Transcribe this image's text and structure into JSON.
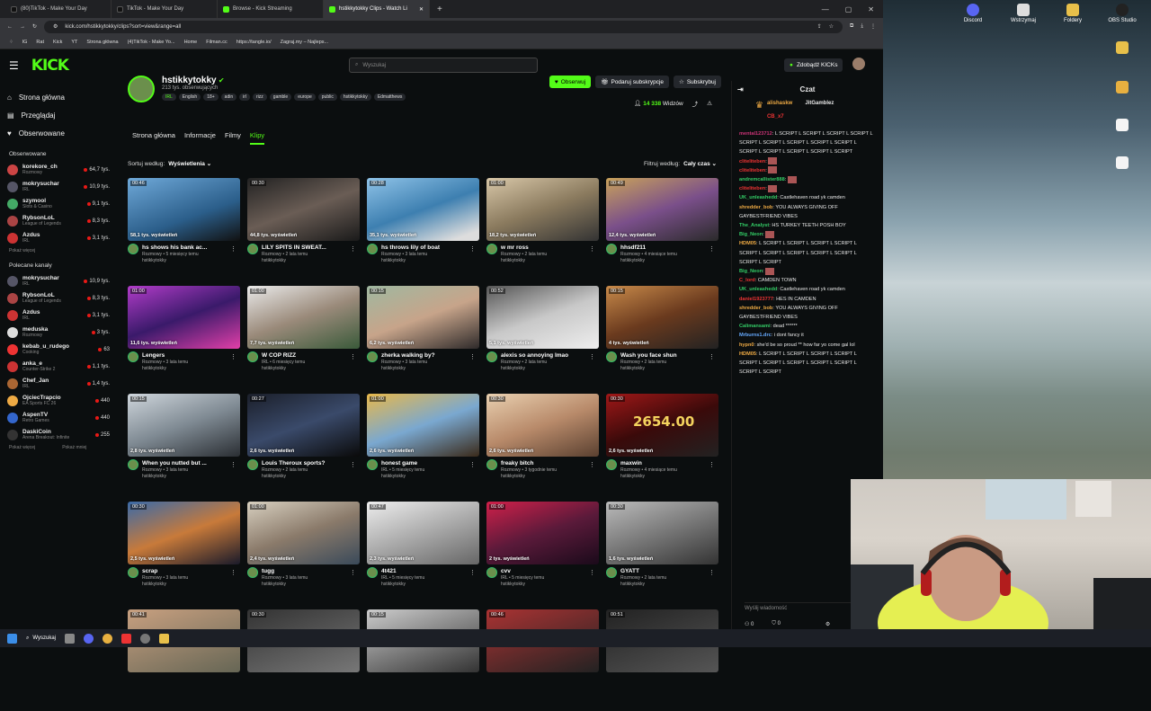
{
  "browser": {
    "tabs": [
      {
        "label": "(80)TikTok - Make Your Day",
        "color": "#222"
      },
      {
        "label": "TikTok - Make Your Day",
        "color": "#222"
      },
      {
        "label": "Browse - Kick Streaming",
        "color": "#53fc18"
      },
      {
        "label": "hstikkytokky Clips - Watch Li",
        "color": "#53fc18"
      }
    ],
    "url": "kick.com/hstikkytokky/clips?sort=view&range=all",
    "bookmarks": [
      "IG",
      "Rat",
      "Kick",
      "YT",
      "Strona główna",
      "(4)TikTok - Make Yo...",
      "Home",
      "Filman.cc",
      "https://tangle.io/",
      "Zagraj.my – Najleps..."
    ]
  },
  "header": {
    "logo": "KICK",
    "search_placeholder": "Wyszukaj",
    "get_kicks": "Zdobądź KICKs"
  },
  "sidebar": {
    "nav": [
      {
        "label": "Strona główna",
        "icon": "home-icon"
      },
      {
        "label": "Przeglądaj",
        "icon": "browse-icon"
      },
      {
        "label": "Obserwowane",
        "icon": "heart-icon"
      }
    ],
    "followed_header": "Obserwowane",
    "followed": [
      {
        "name": "korekore_ch",
        "cat": "Rozmowy",
        "views": "64,7 tys.",
        "color": "#c44"
      },
      {
        "name": "mokrysuchar",
        "cat": "IRL",
        "views": "10,9 tys.",
        "color": "#556"
      },
      {
        "name": "szymool",
        "cat": "Slots & Casino",
        "views": "9,1 tys.",
        "color": "#4a6"
      },
      {
        "name": "RybsonLoL",
        "cat": "League of Legends",
        "views": "8,3 tys.",
        "color": "#a44"
      },
      {
        "name": "Azdus",
        "cat": "IRL",
        "views": "3,1 tys.",
        "color": "#c33"
      }
    ],
    "more": "Pokaż więcej",
    "recommended_header": "Polecane kanały",
    "recommended": [
      {
        "name": "mokrysuchar",
        "cat": "IRL",
        "views": "10,9 tys.",
        "color": "#556"
      },
      {
        "name": "RybsonLoL",
        "cat": "League of Legends",
        "views": "8,3 tys.",
        "color": "#a44"
      },
      {
        "name": "Azdus",
        "cat": "IRL",
        "views": "3,1 tys.",
        "color": "#c33"
      },
      {
        "name": "meduska",
        "cat": "Rozmowy",
        "views": "3 tys.",
        "color": "#ddd"
      },
      {
        "name": "kebab_u_rudego",
        "cat": "Cooking",
        "views": "63",
        "color": "#e33"
      },
      {
        "name": "anka_e",
        "cat": "Counter-Strike 2",
        "views": "1,1 tys.",
        "color": "#c33"
      },
      {
        "name": "Chef_Jan",
        "cat": "IRL",
        "views": "1,4 tys.",
        "color": "#a63"
      },
      {
        "name": "OjciecTrapcio",
        "cat": "EA Sports FC 26",
        "views": "440",
        "color": "#ea4"
      },
      {
        "name": "AspenTV",
        "cat": "Retro Games",
        "views": "440",
        "color": "#36c"
      },
      {
        "name": "DaskiCoin",
        "cat": "Arena Breakout: Infinite",
        "views": "255",
        "color": "#333"
      }
    ],
    "more2": "Pokaż więcej",
    "less": "Pokaż mniej"
  },
  "channel": {
    "name": "hstikkytokky",
    "followers": "213 tys. obserwujących",
    "tags": [
      "IRL",
      "English",
      "18+",
      "adin",
      "irl",
      "rizz",
      "gamble",
      "europe",
      "public",
      "hstikkytokky",
      "Edmatthews"
    ],
    "follow": "Obserwuj",
    "gift": "Podaruj subskrypcje",
    "subscribe": "Subskrybuj",
    "viewers": "14 338",
    "viewers_label": "Widzów",
    "tabs": [
      "Strona główna",
      "Informacje",
      "Filmy",
      "Klipy"
    ],
    "sort_label": "Sortuj według:",
    "sort_value": "Wyświetlenia",
    "filter_label": "Filtruj według:",
    "filter_value": "Cały czas"
  },
  "clips": [
    {
      "dur": "00:46",
      "views": "58,1 tys. wyświetleń",
      "title": "hs shows his bank ac...",
      "sub1": "Rozmowy • 5 miesięcy temu",
      "sub2": "hstikkytokky",
      "bg": "linear-gradient(160deg,#6fa9d9,#2b5e8a 60%,#111)"
    },
    {
      "dur": "00:30",
      "views": "44,8 tys. wyświetleń",
      "title": "LILY SPITS IN SWEAT...",
      "sub1": "Rozmowy • 2 lata temu",
      "sub2": "hstikkytokky",
      "bg": "linear-gradient(160deg,#222,#6a5d55 50%,#1a1a1a)"
    },
    {
      "dur": "00:28",
      "views": "35,1 tys. wyświetleń",
      "title": "hs throws lily of boat",
      "sub1": "Rozmowy • 3 lata temu",
      "sub2": "hstikkytokky",
      "bg": "linear-gradient(160deg,#8fc3e8,#3d7fb0 50%,#ddd 90%)"
    },
    {
      "dur": "01:00",
      "views": "18,2 tys. wyświetleń",
      "title": "w mr ross",
      "sub1": "Rozmowy • 2 lata temu",
      "sub2": "hstikkytokky",
      "bg": "linear-gradient(160deg,#d8c7a8,#8a7a5e 50%,#333)"
    },
    {
      "dur": "00:49",
      "views": "12,4 tys. wyświetleń",
      "title": "hhsdf211",
      "sub1": "Rozmowy • 4 miesiące temu",
      "sub2": "hstikkytokky",
      "bg": "linear-gradient(160deg,#c9a25a,#7a4f8a 50%,#2a2a2a)"
    },
    {
      "dur": "01:00",
      "views": "11,6 tys. wyświetleń",
      "title": "Lengers",
      "sub1": "Rozmowy • 3 lata temu",
      "sub2": "hstikkytokky",
      "bg": "linear-gradient(160deg,#b23cc9,#3a1a6a 50%,#e23fa8)"
    },
    {
      "dur": "01:00",
      "views": "7,7 tys. wyświetleń",
      "title": "W COP RIZZ",
      "sub1": "IRL • 6 miesięcy temu",
      "sub2": "hstikkytokky",
      "bg": "linear-gradient(160deg,#eaeaea,#9a8a7a 50%,#3a5a3a)"
    },
    {
      "dur": "00:15",
      "views": "6,2 tys. wyświetleń",
      "title": "zherka walking by?",
      "sub1": "Rozmowy • 3 lata temu",
      "sub2": "hstikkytokky",
      "bg": "linear-gradient(160deg,#9fb8a0,#c7a48a 50%,#2e2a2a)"
    },
    {
      "dur": "00:52",
      "views": "5,1 tys. wyświetleń",
      "title": "alexis so annoying lmao",
      "sub1": "Rozmowy • 2 lata temu",
      "sub2": "hstikkytokky",
      "bg": "linear-gradient(160deg,#555,#c8c8c8 50%,#eee)"
    },
    {
      "dur": "00:15",
      "views": "4 tys. wyświetleń",
      "title": "Wash you face shun",
      "sub1": "Rozmowy • 2 lata temu",
      "sub2": "hstikkytokky",
      "bg": "linear-gradient(160deg,#c88a4a,#6a3a1e 50%,#222)"
    },
    {
      "dur": "00:15",
      "views": "2,8 tys. wyświetleń",
      "title": "When you nutted but ...",
      "sub1": "Rozmowy • 3 lata temu",
      "sub2": "hstikkytokky",
      "bg": "linear-gradient(160deg,#cfd6dc,#7f8a93 50%,#2a2e33)"
    },
    {
      "dur": "00:27",
      "views": "2,6 tys. wyświetleń",
      "title": "Louis Theroux sports?",
      "sub1": "Rozmowy • 2 lata temu",
      "sub2": "hstikkytokky",
      "bg": "linear-gradient(160deg,#1b1f2a,#3a4a6a 50%,#0a0a0a)"
    },
    {
      "dur": "01:00",
      "views": "2,6 tys. wyświetleń",
      "title": "honest game",
      "sub1": "IRL • 5 miesięcy temu",
      "sub2": "hstikkytokky",
      "bg": "linear-gradient(160deg,#e8b84a,#7aa8d0 50%,#3a2a1a)"
    },
    {
      "dur": "00:30",
      "views": "2,6 tys. wyświetleń",
      "title": "freaky bitch",
      "sub1": "Rozmowy • 3 tygodnie temu",
      "sub2": "hstikkytokky",
      "bg": "linear-gradient(160deg,#e9d0b0,#b88a6a 50%,#5a4030)"
    },
    {
      "dur": "00:30",
      "views": "2,6 tys. wyświetleń",
      "title": "maxwin",
      "sub1": "Rozmowy • 4 miesiące temu",
      "sub2": "hstikkytokky",
      "bg": "linear-gradient(160deg,#a01818,#3a0a0a 50%,#222)",
      "overlay": "2654.00"
    },
    {
      "dur": "00:30",
      "views": "2,5 tys. wyświetleń",
      "title": "scrap",
      "sub1": "Rozmowy • 3 lata temu",
      "sub2": "hstikkytokky",
      "bg": "linear-gradient(160deg,#3a6aa8,#c87a3a 50%,#1a1a2a)"
    },
    {
      "dur": "01:00",
      "views": "2,4 tys. wyświetleń",
      "title": "tugg",
      "sub1": "Rozmowy • 3 lata temu",
      "sub2": "hstikkytokky",
      "bg": "linear-gradient(160deg,#d8d0c0,#8a7a6a 50%,#3a4a5a)"
    },
    {
      "dur": "00:47",
      "views": "2,3 tys. wyświetleń",
      "title": "4t421",
      "sub1": "IRL • 5 miesięcy temu",
      "sub2": "hstikkytokky",
      "bg": "linear-gradient(160deg,#eee,#aaa 50%,#666)"
    },
    {
      "dur": "01:00",
      "views": "2 tys. wyświetleń",
      "title": "cvv",
      "sub1": "IRL • 5 miesięcy temu",
      "sub2": "hstikkytokky",
      "bg": "linear-gradient(160deg,#d0204a,#5a1a3a 50%,#1a0a1a)"
    },
    {
      "dur": "00:30",
      "views": "1,6 tys. wyświetleń",
      "title": "GYATT",
      "sub1": "Rozmowy • 2 lata temu",
      "sub2": "hstikkytokky",
      "bg": "linear-gradient(160deg,#bbb,#777 50%,#333)"
    },
    {
      "dur": "00:41",
      "views": "",
      "title": "",
      "sub1": "",
      "sub2": "",
      "bg": "linear-gradient(160deg,#c8a080,#665)"
    },
    {
      "dur": "00:30",
      "views": "",
      "title": "",
      "sub1": "",
      "sub2": "",
      "bg": "linear-gradient(160deg,#333,#777)"
    },
    {
      "dur": "00:15",
      "views": "",
      "title": "",
      "sub1": "",
      "sub2": "",
      "bg": "linear-gradient(160deg,#ccc,#333)"
    },
    {
      "dur": "00:46",
      "views": "",
      "title": "",
      "sub1": "",
      "sub2": "",
      "bg": "linear-gradient(160deg,#a33,#222)"
    },
    {
      "dur": "00:51",
      "views": "",
      "title": "",
      "sub1": "",
      "sub2": "",
      "bg": "linear-gradient(160deg,#222,#555)"
    }
  ],
  "chat": {
    "title": "Czat",
    "pinned": [
      {
        "name": "alishaskw",
        "color": "#ea4"
      },
      {
        "name": "JitGamblez",
        "color": "#fff"
      },
      {
        "name": "CB_x7",
        "color": "#e33"
      }
    ],
    "messages": [
      {
        "user": "mental123712",
        "color": "#c37",
        "text": "L SCRIPT L SCRIPT L SCRIPT L SCRIPT L SCRIPT L SCRIPT L SCRIPT L SCRIPT L SCRIPT L SCRIPT L SCRIPT L SCRIPT L SCRIPT L SCRIPT"
      },
      {
        "user": "cliteliteben",
        "color": "#e33",
        "text": ""
      },
      {
        "user": "cliteliteben",
        "color": "#e33",
        "text": ""
      },
      {
        "user": "andremcallister888",
        "color": "#3c6",
        "text": ""
      },
      {
        "user": "cliteliteben",
        "color": "#e33",
        "text": ""
      },
      {
        "user": "UK_unleashedd",
        "color": "#3c6",
        "text": "Castlehaven road yk camden"
      },
      {
        "user": "shredder_bob",
        "color": "#ea4",
        "text": "YOU ALWAYS GIVING OFF GAYBESTFRIEND VIBES"
      },
      {
        "user": "The_Analyst",
        "color": "#3c6",
        "text": "HS TURKEY TEETH POSH BOY"
      },
      {
        "user": "Big_Neon",
        "color": "#3c6",
        "text": ""
      },
      {
        "user": "HDM05",
        "color": "#ea4",
        "text": "L SCRIPT L SCRIPT L SCRIPT L SCRIPT L SCRIPT L SCRIPT L SCRIPT L SCRIPT L SCRIPT L SCRIPT L SCRIPT"
      },
      {
        "user": "Big_Neon",
        "color": "#3c6",
        "text": ""
      },
      {
        "user": "C_lord",
        "color": "#e33",
        "text": "CAMDEN TOWN"
      },
      {
        "user": "UK_unleashedd",
        "color": "#3c6",
        "text": "Castlehaven road yk camden"
      },
      {
        "user": "daniel1923777",
        "color": "#e33",
        "text": "HES IN CAMDEN"
      },
      {
        "user": "shredder_bob",
        "color": "#ea4",
        "text": "YOU ALWAYS GIVING OFF GAYBESTFRIEND VIBES"
      },
      {
        "user": "Calimansami",
        "color": "#3c6",
        "text": "dead ******"
      },
      {
        "user": "Mrburns1.drc",
        "color": "#6af",
        "text": "i dont fancy it"
      },
      {
        "user": "hypn0",
        "color": "#ea4",
        "text": "she'd be so proud ** how far yo come gal lol"
      },
      {
        "user": "HDM05",
        "color": "#ea4",
        "text": "L SCRIPT L SCRIPT L SCRIPT L SCRIPT L SCRIPT L SCRIPT L SCRIPT L SCRIPT L SCRIPT L SCRIPT L SCRIPT"
      }
    ],
    "input_placeholder": "Wyślij wiadomość",
    "count_a": "0",
    "count_b": "0"
  },
  "desktop": {
    "icons": [
      "Discord",
      "Wstrzymaj",
      "Foldery",
      "OBS Studio",
      "",
      "",
      "",
      ""
    ]
  },
  "taskbar": {
    "search": "Wyszukaj"
  }
}
